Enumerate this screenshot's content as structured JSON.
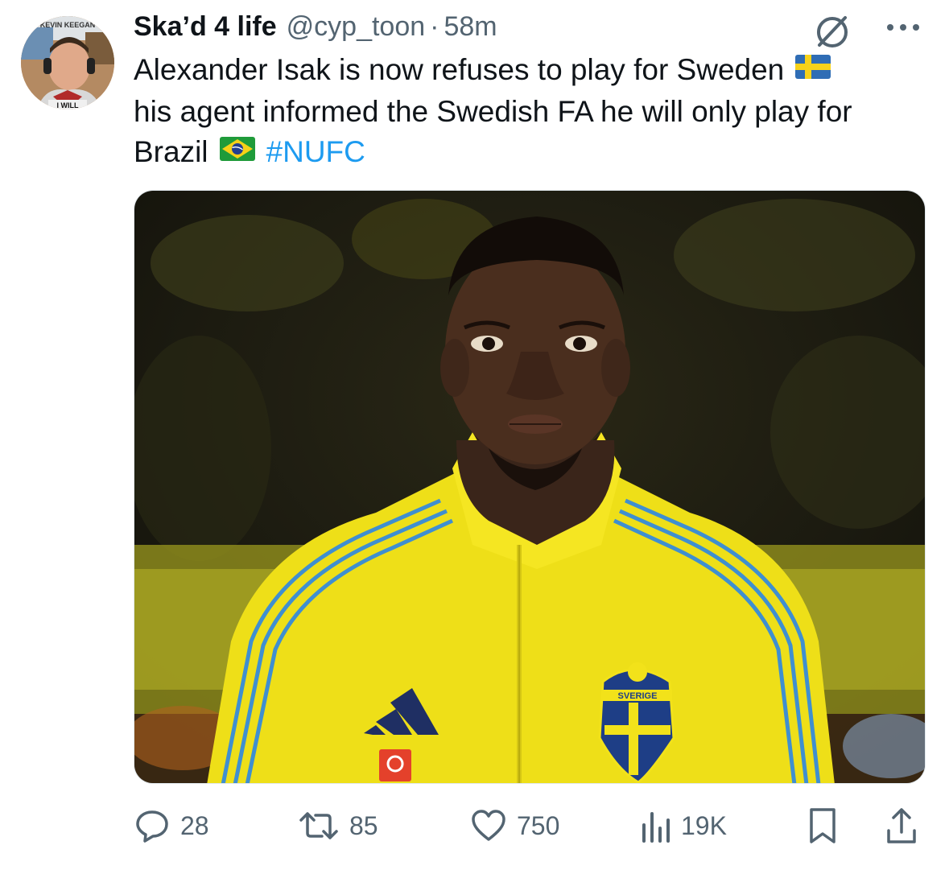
{
  "tweet": {
    "author_name": "Ska’d 4 life",
    "handle": "@cyp_toon",
    "separator": "·",
    "time": "58m",
    "text_line1": "Alexander Isak is now refuses to play for Sweden",
    "text_line2": "his agent informed the Swedish FA he will only play for",
    "text_line3": "Brazil",
    "hashtag": "#NUFC",
    "avatar_text": "KEVIN KEEGAN",
    "avatar_bottom_text": "I WILL",
    "flags": [
      "sweden-flag",
      "brazil-flag"
    ]
  },
  "media": {
    "jacket_badge_text": "SVERIGE",
    "colors": {
      "jacket": "#f2e21a",
      "stripe": "#3f8fd0",
      "background": "#1d1b0f"
    }
  },
  "actions": {
    "replies": "28",
    "reposts": "85",
    "likes": "750",
    "views": "19K"
  },
  "icons": [
    "grok-icon",
    "more-icon",
    "reply-icon",
    "repost-icon",
    "like-icon",
    "views-icon",
    "bookmark-icon",
    "share-icon"
  ],
  "colors": {
    "link": "#1d9bf0",
    "secondary_text": "#536471",
    "primary_text": "#0f1419"
  }
}
